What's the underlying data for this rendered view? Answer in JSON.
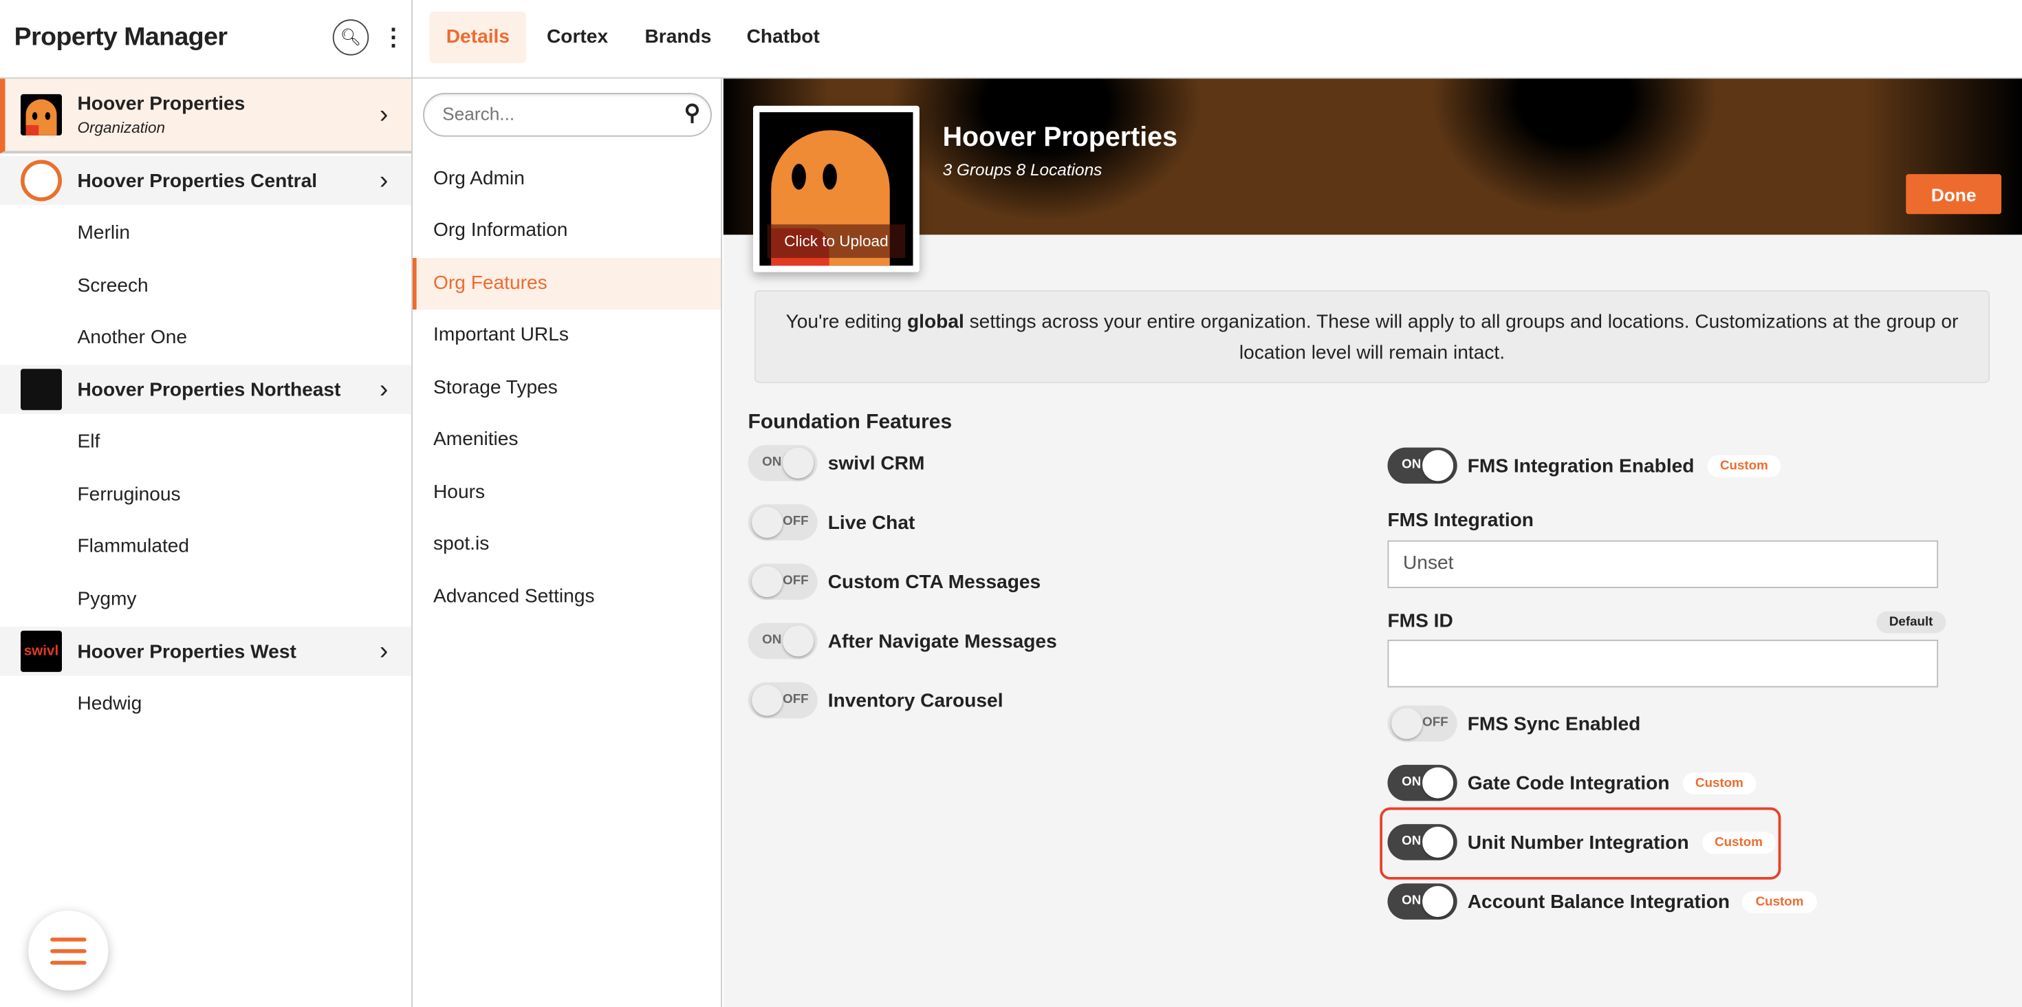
{
  "app": {
    "title": "Property Manager"
  },
  "tabs": [
    {
      "label": "Details",
      "active": true
    },
    {
      "label": "Cortex"
    },
    {
      "label": "Brands"
    },
    {
      "label": "Chatbot"
    }
  ],
  "tree": {
    "org": {
      "name": "Hoover Properties",
      "sub": "Organization"
    },
    "groups": [
      {
        "name": "Hoover Properties Central",
        "locations": [
          "Merlin",
          "Screech",
          "Another One"
        ]
      },
      {
        "name": "Hoover Properties Northeast",
        "locations": [
          "Elf",
          "Ferruginous",
          "Flammulated",
          "Pygmy"
        ]
      },
      {
        "name": "Hoover Properties West",
        "avatar_text": "swivl",
        "locations": [
          "Hedwig"
        ]
      }
    ]
  },
  "menu": {
    "search_placeholder": "Search...",
    "items": [
      "Org Admin",
      "Org Information",
      "Org Features",
      "Important URLs",
      "Storage Types",
      "Amenities",
      "Hours",
      "spot.is",
      "Advanced Settings"
    ],
    "active": "Org Features"
  },
  "header": {
    "title": "Hoover Properties",
    "subtitle": "3 Groups 8 Locations",
    "upload": "Click to Upload",
    "done": "Done"
  },
  "notice": {
    "pre": "You're editing ",
    "bold": "global",
    "post": " settings across your entire organization. These will apply to all groups and locations. Customizations at the group or location level will remain intact."
  },
  "features": {
    "section": "Foundation Features",
    "left": [
      {
        "label": "swivl CRM",
        "state": "ON"
      },
      {
        "label": "Live Chat",
        "state": "OFF"
      },
      {
        "label": "Custom CTA Messages",
        "state": "OFF"
      },
      {
        "label": "After Navigate Messages",
        "state": "ON"
      },
      {
        "label": "Inventory Carousel",
        "state": "OFF"
      }
    ],
    "fms_enabled": {
      "label": "FMS Integration Enabled",
      "state": "ON",
      "badge": "Custom"
    },
    "fms_integration": {
      "label": "FMS Integration",
      "value": "Unset"
    },
    "fms_id": {
      "label": "FMS ID",
      "value": "",
      "badge": "Default"
    },
    "right": [
      {
        "label": "FMS Sync Enabled",
        "state": "OFF",
        "badge": ""
      },
      {
        "label": "Gate Code Integration",
        "state": "ON",
        "badge": "Custom"
      },
      {
        "label": "Unit Number Integration",
        "state": "ON",
        "badge": "Custom"
      },
      {
        "label": "Account Balance Integration",
        "state": "ON",
        "badge": "Custom"
      }
    ]
  },
  "colors": {
    "accent": "#ee6b2e",
    "highlight": "#e8402a",
    "toggle_on": "#444444"
  }
}
